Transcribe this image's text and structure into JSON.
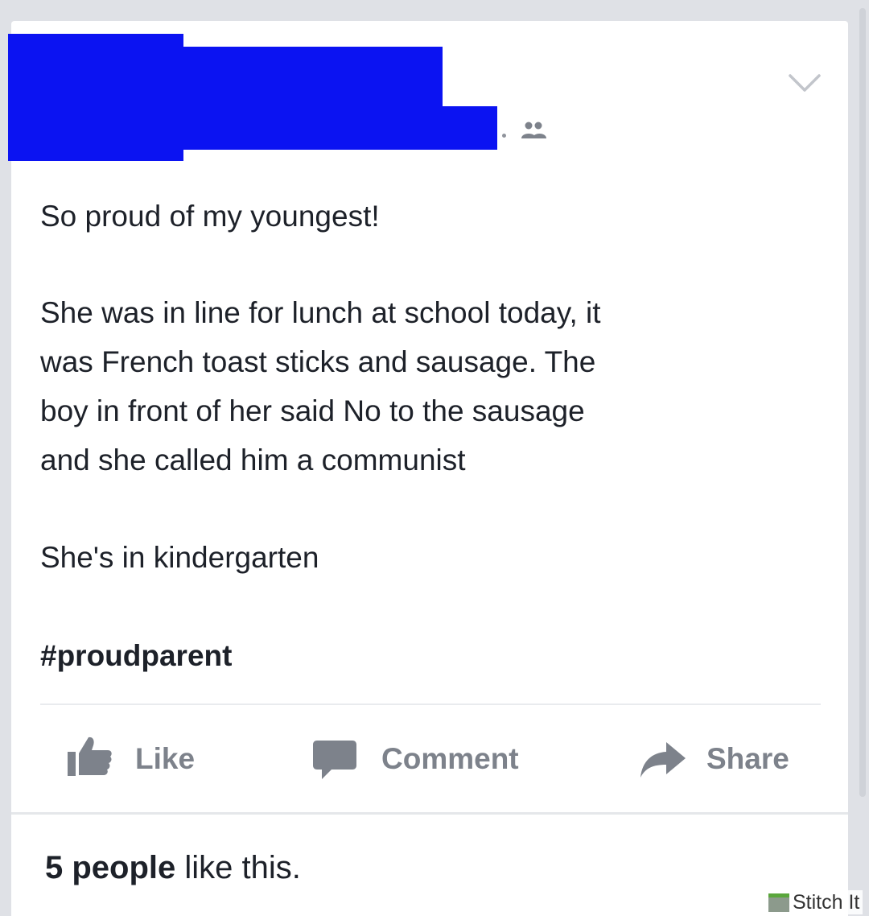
{
  "post": {
    "header": {
      "author_redacted": true,
      "audience_icon": "friends-icon",
      "menu_icon": "chevron-down-icon"
    },
    "body": {
      "line1": "So proud of my youngest!",
      "line2": "She was in line for lunch at school today, it",
      "line3": "was French toast sticks and sausage. The",
      "line4": "boy in front of her said No to the sausage",
      "line5": "and she called him a communist",
      "line6": "She's in kindergarten",
      "hashtag": "#proudparent"
    },
    "actions": {
      "like": {
        "label": "Like",
        "icon": "thumbs-up-icon"
      },
      "comment": {
        "label": "Comment",
        "icon": "speech-bubble-icon"
      },
      "share": {
        "label": "Share",
        "icon": "share-arrow-icon"
      }
    },
    "likes": {
      "count_text": "5 people",
      "suffix": " like this."
    }
  },
  "watermark": {
    "text": "Stitch It"
  },
  "colors": {
    "redaction": "#0b13f2",
    "action_gray": "#7d828b",
    "text": "#1d2129",
    "background": "#dfe1e6"
  }
}
